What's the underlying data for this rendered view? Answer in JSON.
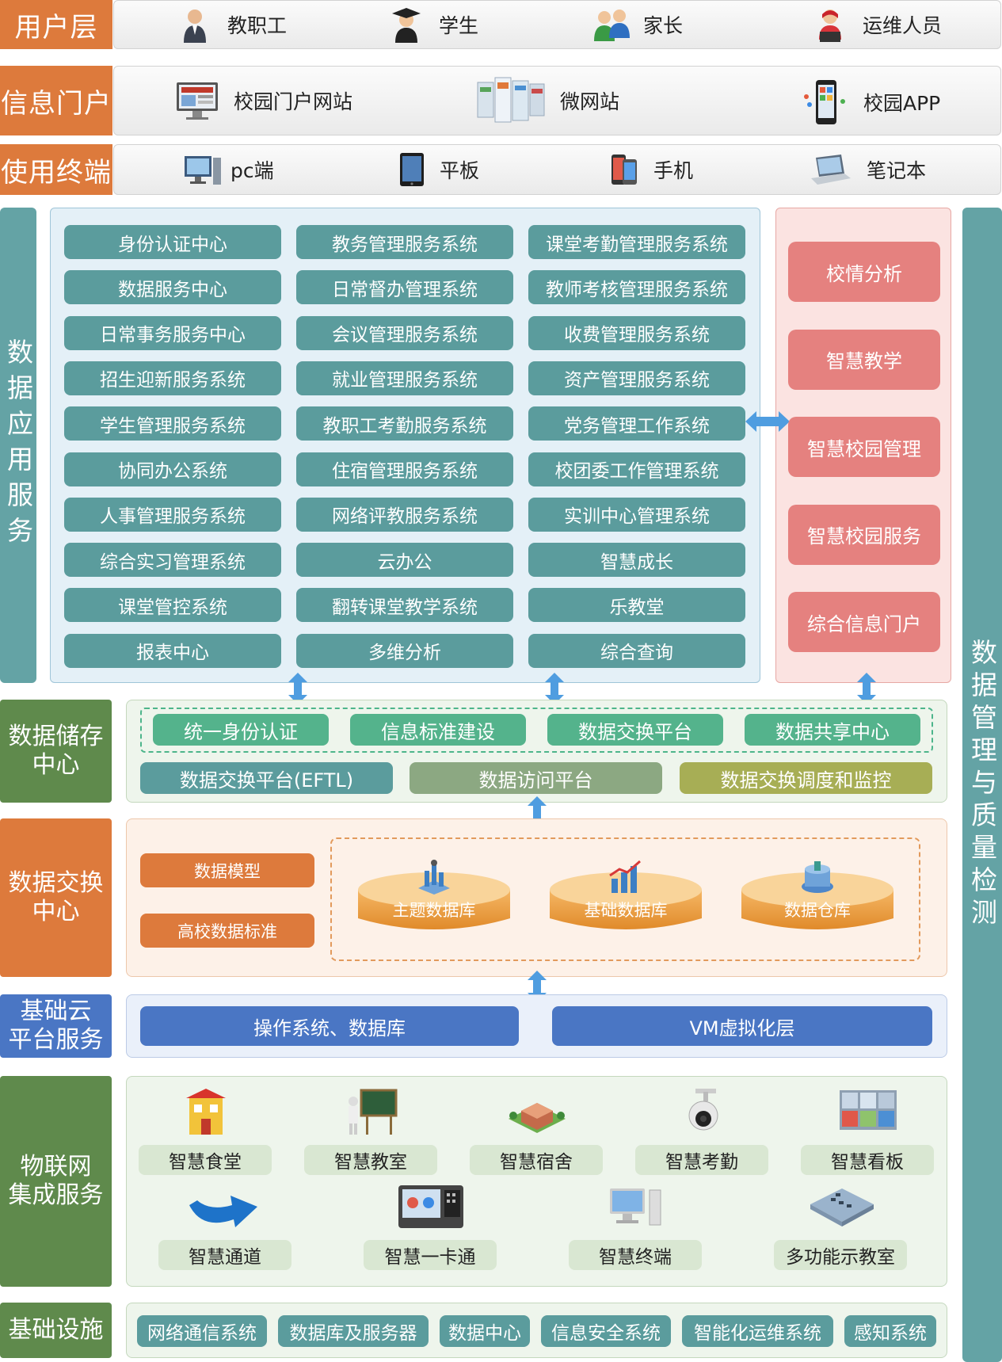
{
  "colors": {
    "orange": "#dd7a3c",
    "teal": "#5b9c9d",
    "side_teal": "#64a3a5",
    "pink": "#e5817f",
    "green_dark": "#5f8a4c",
    "green_pill": "#54b38c",
    "blue": "#4a76c4",
    "olive": "#a7ae55",
    "sage": "#8ca882",
    "arrow_blue": "#4f9de0"
  },
  "rows": {
    "users": {
      "label": "用户层",
      "items": [
        {
          "label": "教职工",
          "icon": "teacher-icon"
        },
        {
          "label": "学生",
          "icon": "student-icon"
        },
        {
          "label": "家长",
          "icon": "parents-icon"
        },
        {
          "label": "运维人员",
          "icon": "operator-icon"
        }
      ]
    },
    "portal": {
      "label": "信息门户",
      "items": [
        {
          "label": "校园门户网站",
          "icon": "website-icon"
        },
        {
          "label": "微网站",
          "icon": "micro-site-icon"
        },
        {
          "label": "校园APP",
          "icon": "app-icon"
        }
      ]
    },
    "terminal": {
      "label": "使用终端",
      "items": [
        {
          "label": "pc端",
          "icon": "pc-icon"
        },
        {
          "label": "平板",
          "icon": "tablet-icon"
        },
        {
          "label": "手机",
          "icon": "phone-icon"
        },
        {
          "label": "笔记本",
          "icon": "laptop-icon"
        }
      ]
    }
  },
  "app_service": {
    "label": "数据应用服务",
    "systems": [
      [
        "身份认证中心",
        "教务管理服务系统",
        "课堂考勤管理服务系统"
      ],
      [
        "数据服务中心",
        "日常督办管理系统",
        "教师考核管理服务系统"
      ],
      [
        "日常事务服务中心",
        "会议管理服务系统",
        "收费管理服务系统"
      ],
      [
        "招生迎新服务系统",
        "就业管理服务系统",
        "资产管理服务系统"
      ],
      [
        "学生管理服务系统",
        "教职工考勤服务系统",
        "党务管理工作系统"
      ],
      [
        "协同办公系统",
        "住宿管理服务系统",
        "校团委工作管理系统"
      ],
      [
        "人事管理服务系统",
        "网络评教服务系统",
        "实训中心管理系统"
      ],
      [
        "综合实习管理系统",
        "云办公",
        "智慧成长"
      ],
      [
        "课堂管控系统",
        "翻转课堂教学系统",
        "乐教堂"
      ],
      [
        "报表中心",
        "多维分析",
        "综合查询"
      ]
    ],
    "smart": [
      "校情分析",
      "智慧教学",
      "智慧校园管理",
      "智慧校园服务",
      "综合信息门户"
    ]
  },
  "right_label": "数据管理与质量检测",
  "storage": {
    "label_1": "数据储存",
    "label_2": "中心",
    "top": [
      "统一身份认证",
      "信息标准建设",
      "数据交换平台",
      "数据共享中心"
    ],
    "bottom": [
      "数据交换平台(EFTL)",
      "数据访问平台",
      "数据交换调度和监控"
    ]
  },
  "exchange": {
    "label_1": "数据交换",
    "label_2": "中心",
    "left": [
      "数据模型",
      "高校数据标准"
    ],
    "databases": [
      "主题数据库",
      "基础数据库",
      "数据仓库"
    ]
  },
  "cloud": {
    "label_1": "基础云",
    "label_2": "平台服务",
    "items": [
      "操作系统、数据库",
      "VM虚拟化层"
    ]
  },
  "iot": {
    "label_1": "物联网",
    "label_2": "集成服务",
    "row1": [
      "智慧食堂",
      "智慧教室",
      "智慧宿舍",
      "智慧考勤",
      "智慧看板"
    ],
    "row2": [
      "智慧通道",
      "智慧一卡通",
      "智慧终端",
      "多功能示教室"
    ]
  },
  "infra": {
    "label": "基础设施",
    "items": [
      "网络通信系统",
      "数据库及服务器",
      "数据中心",
      "信息安全系统",
      "智能化运维系统",
      "感知系统"
    ]
  }
}
